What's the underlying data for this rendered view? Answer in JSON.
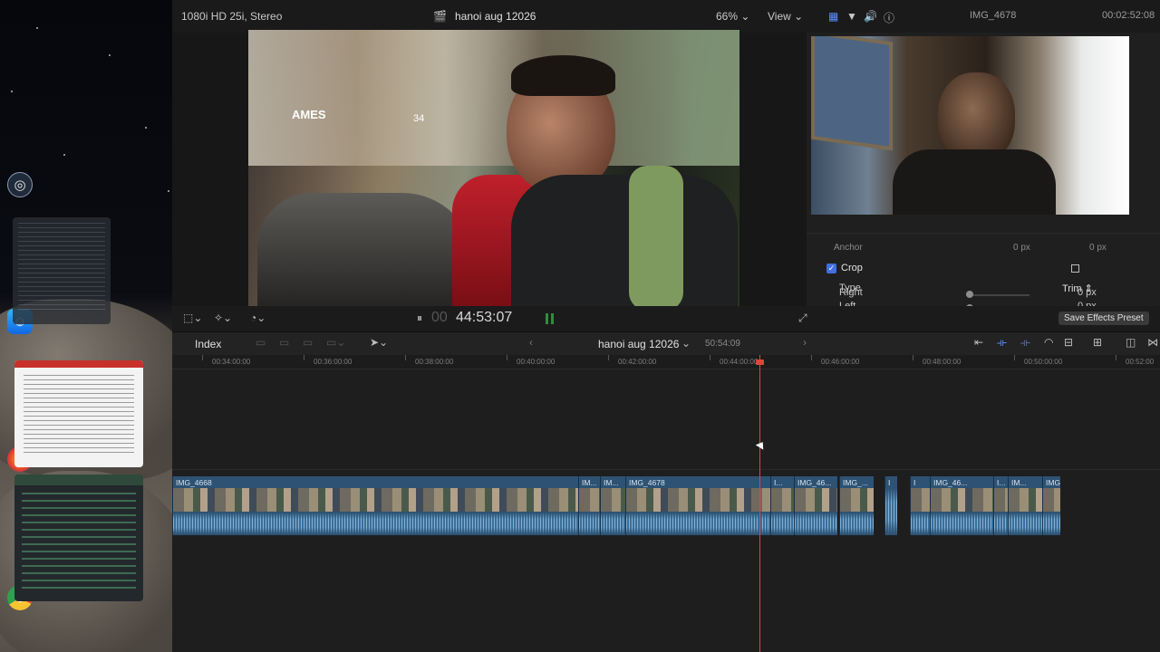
{
  "topbar": {
    "format": "1080i HD 25i, Stereo",
    "project_title": "hanoi aug 12026",
    "zoom": "66%",
    "view_label": "View",
    "inspector_clip_name": "IMG_4678",
    "inspector_duration": "00:02:52:08"
  },
  "viewer": {
    "timecode": "44:53:07",
    "timecode_prefix": "00"
  },
  "inspector": {
    "anchor_label": "Anchor",
    "anchor_x": "0 px",
    "anchor_y": "0 px",
    "crop_label": "Crop",
    "type_label": "Type",
    "type_value": "Trim",
    "left_label": "Left",
    "left_value": "0 px",
    "right_label": "Right",
    "right_value": "0 px",
    "save_preset": "Save Effects Preset"
  },
  "timeline_header": {
    "index_label": "Index",
    "project_name": "hanoi aug 12026",
    "project_duration": "50:54:09"
  },
  "ruler": {
    "ticks": [
      "00:34:00:00",
      "00:36:00:00",
      "00:38:00:00",
      "00:40:00:00",
      "00:42:00:00",
      "00:44:00:00",
      "00:46:00:00",
      "00:48:00:00",
      "00:50:00:00",
      "00:52:00"
    ]
  },
  "clips": [
    {
      "label": "IMG_4668"
    },
    {
      "label": "IM..."
    },
    {
      "label": "IM..."
    },
    {
      "label": "IMG_4678"
    },
    {
      "label": "I..."
    },
    {
      "label": "IMG_46..."
    },
    {
      "label": "IMG_..."
    },
    {
      "label": "I"
    },
    {
      "label": "I"
    },
    {
      "label": "IMG_46..."
    },
    {
      "label": "I..."
    },
    {
      "label": "IM..."
    },
    {
      "label": "IMG_..."
    }
  ],
  "video_overlay_text": {
    "sign_left": "AMES",
    "sign_mid": "34"
  },
  "colors": {
    "playhead": "#e0453a",
    "clip_blue": "#2d5273",
    "accent": "#5b8cff"
  }
}
